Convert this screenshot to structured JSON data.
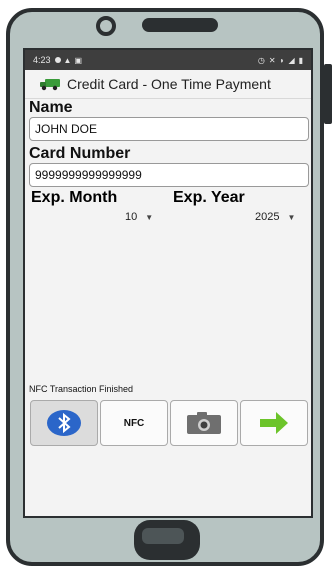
{
  "status_bar": {
    "time": "4:23"
  },
  "app": {
    "title": "Credit Card - One Time Payment"
  },
  "form": {
    "name_label": "Name",
    "name_value": "JOHN DOE",
    "card_label": "Card Number",
    "card_value": "9999999999999999",
    "exp_month_label": "Exp. Month",
    "exp_month_value": "10",
    "exp_year_label": "Exp. Year",
    "exp_year_value": "2025"
  },
  "nfc_status": "NFC Transaction Finished",
  "buttons": {
    "nfc_label": "NFC"
  },
  "colors": {
    "bluetooth_bg": "#2b66c9",
    "arrow_green": "#6cc42a",
    "phone_body": "#b7c4c2"
  }
}
